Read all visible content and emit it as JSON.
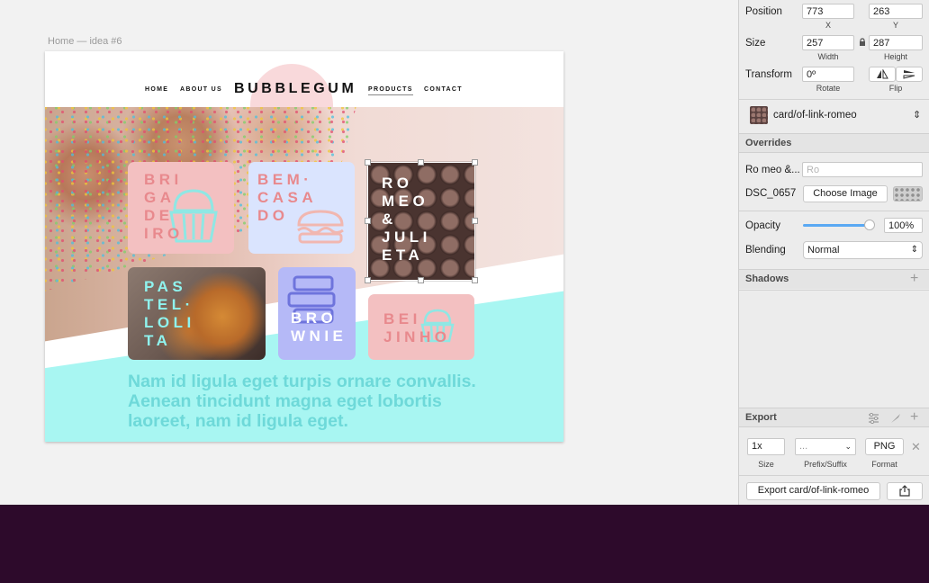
{
  "canvas": {
    "artboard_label": "Home — idea #6",
    "nav": {
      "items": [
        "HOME",
        "ABOUT US",
        "PRODUCTS",
        "CONTACT"
      ],
      "brand": "BUBBLEGUM",
      "active": "PRODUCTS"
    },
    "cards": {
      "brigadeiro": "BRI\nGA\nDE\nIRO",
      "bem_casado": "BEM·\nCASA\nDO",
      "romeo": "RO\nMEO\n&\nJULI\nETA",
      "pastel": "PAS\nTEL·\nLOLI\nTA",
      "brownie": "BRO\nWNIE",
      "beijinho": "BEI\nJINHO"
    },
    "body_text": "Nam id ligula eget turpis ornare convallis. Aenean tincidunt magna eget lobortis laoreet, nam id ligula eget.",
    "colors": {
      "pink": "#f3c0c1",
      "pink_text": "#e8898d",
      "lavender": "#dae4fe",
      "periwinkle": "#b5b9f7",
      "cyan": "#a8f6f2",
      "cyan_text": "#6ed9d9"
    }
  },
  "inspector": {
    "position": {
      "label": "Position",
      "x": "773",
      "y": "263",
      "x_label": "X",
      "y_label": "Y"
    },
    "size": {
      "label": "Size",
      "width": "257",
      "height": "287",
      "width_label": "Width",
      "height_label": "Height"
    },
    "transform": {
      "label": "Transform",
      "rotate": "0º",
      "rotate_label": "Rotate",
      "flip_label": "Flip"
    },
    "symbol": {
      "name": "card/of-link-romeo"
    },
    "overrides": {
      "title": "Overrides",
      "text_label": "Ro meo &...",
      "text_placeholder": "Ro",
      "image_label": "DSC_0657",
      "choose_image": "Choose Image"
    },
    "opacity": {
      "label": "Opacity",
      "value": "100%",
      "level": 1.0
    },
    "blending": {
      "label": "Blending",
      "value": "Normal"
    },
    "shadows": {
      "title": "Shadows"
    },
    "export": {
      "title": "Export",
      "size": "1x",
      "prefix": "...",
      "format": "PNG",
      "size_label": "Size",
      "prefix_label": "Prefix/Suffix",
      "format_label": "Format",
      "export_button": "Export card/of-link-romeo"
    }
  }
}
